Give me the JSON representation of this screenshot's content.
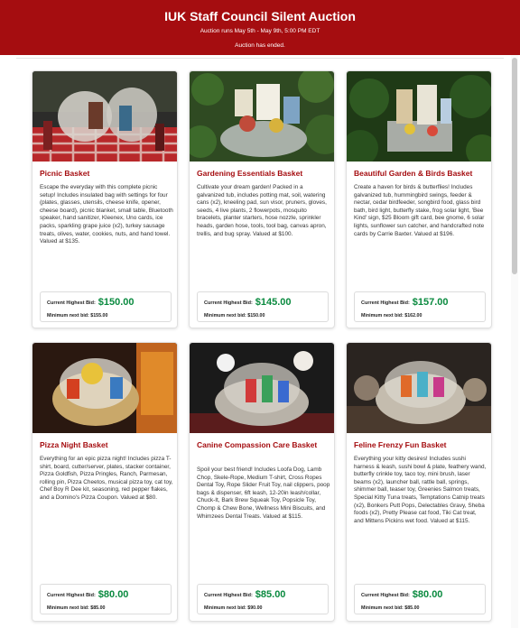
{
  "header": {
    "title": "IUK Staff Council Silent Auction",
    "subtitle": "Auction runs May 5th - May 9th, 5:00 PM EDT",
    "status": "Auction has ended.",
    "bg_color": "#a50d10"
  },
  "labels": {
    "current_bid": "Current Highest Bid:",
    "min_next": "Minimum next bid:"
  },
  "items": [
    {
      "name": "Picnic Basket",
      "description": "Escape the everyday with this complete picnic setup! Includes insulated bag with settings for four (plates, glasses, utensils, cheese knife, opener, cheese board), picnic blanket, small table, Bluetooth speaker, hand sanitizer, Kleenex, Uno cards, ice packs, sparkling grape juice (x2), turkey sausage treats, olives, water, cookies, nuts, and hand towel. Valued at $135.",
      "current_bid": "$150.00",
      "min_next_bid": "$155.00"
    },
    {
      "name": "Gardening Essentials Basket",
      "description": "Cultivate your dream garden! Packed in a galvanized tub, includes potting mat, soil, watering cans (x2), kneeling pad, sun visor, pruners, gloves, seeds, 4 live plants, 2 flowerpots, mosquito bracelets, planter starters, hose nozzle, sprinkler heads, garden hose, tools, tool bag, canvas apron, trellis, and bug spray. Valued at $100.",
      "current_bid": "$145.00",
      "min_next_bid": "$150.00"
    },
    {
      "name": "Beautiful Garden & Birds Basket",
      "description": "Create a haven for birds & butterflies! Includes galvanized tub, hummingbird swings, feeder & nectar, cedar birdfeeder, songbird food, glass bird bath, bird light, butterfly stake, frog solar light, 'Bee Kind' sign, $25 Bloom gift card, bee gnome, 6 solar lights, sunflower sun catcher, and handcrafted note cards by Carrie Baxter. Valued at $196.",
      "current_bid": "$157.00",
      "min_next_bid": "$162.00"
    },
    {
      "name": "Pizza Night Basket",
      "description": "Everything for an epic pizza night! Includes pizza T-shirt, board, cutter/server, plates, stacker container, Pizza Goldfish, Pizza Pringles, Ranch, Parmesan, rolling pin, Pizza Cheetos, musical pizza toy, cat toy, Chef Boy R Dee kit, seasoning, red pepper flakes, and a Domino's Pizza Coupon. Valued at $80.",
      "current_bid": "$80.00",
      "min_next_bid": "$85.00"
    },
    {
      "name": "Canine Compassion Care Basket",
      "description": "Spoil your best friend! Includes Loofa Dog, Lamb Chop, Skele-Rope, Medium T-shirt, Cross Ropes Dental Toy, Rope Slider Fruit Toy, nail clippers, poop bags & dispenser, 6ft leash, 12-20in leash/collar, Chuck-It, Bark Brew Squeak Toy, Popsicle Toy, Chomp & Chew Bone, Wellness Mini Biscuits, and Whimzees Dental Treats. Valued at $115.",
      "current_bid": "$85.00",
      "min_next_bid": "$90.00"
    },
    {
      "name": "Feline Frenzy Fun Basket",
      "description": "Everything your kitty desires! Includes sushi harness & leash, sushi bowl & plate, feathery wand, butterfly crinkle toy, taco toy, mini brush, laser beams (x2), launcher ball, rattle ball, springs, shimmer ball, teaser toy, Greenies Salmon treats, Special Kitty Tuna treats, Temptations Catnip treats (x2), Bonkers Putt Pops, Delectables Gravy, Sheba foods (x2), Pretty Please cat food, Tiki Cat treat, and Mittens Pickins wet food. Valued at $115.",
      "current_bid": "$80.00",
      "min_next_bid": "$85.00"
    }
  ]
}
